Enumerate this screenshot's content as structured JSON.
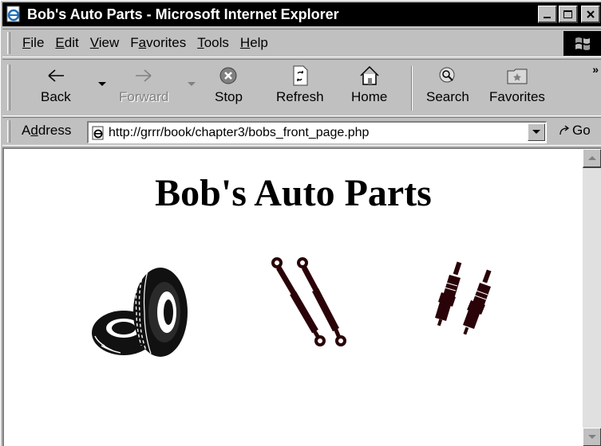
{
  "window": {
    "title": "Bob's Auto Parts - Microsoft Internet Explorer",
    "icon": "ie-page-icon",
    "buttons": [
      "minimize-icon",
      "maximize-icon",
      "close-icon"
    ]
  },
  "menu": {
    "items": [
      {
        "label": "File",
        "accel": "F",
        "rest": "ile"
      },
      {
        "label": "Edit",
        "accel": "E",
        "rest": "dit"
      },
      {
        "label": "View",
        "accel": "V",
        "rest": "iew"
      },
      {
        "label": "Favorites",
        "pre": "F",
        "accel": "a",
        "rest": "vorites"
      },
      {
        "label": "Tools",
        "accel": "T",
        "rest": "ools"
      },
      {
        "label": "Help",
        "accel": "H",
        "rest": "elp"
      }
    ]
  },
  "toolbar": {
    "back": {
      "label": "Back",
      "icon": "back-arrow-icon",
      "enabled": true
    },
    "forward": {
      "label": "Forward",
      "icon": "forward-arrow-icon",
      "enabled": false
    },
    "stop": {
      "label": "Stop",
      "icon": "stop-icon"
    },
    "refresh": {
      "label": "Refresh",
      "icon": "refresh-icon"
    },
    "home": {
      "label": "Home",
      "icon": "home-icon"
    },
    "search": {
      "label": "Search",
      "icon": "search-icon"
    },
    "favorites": {
      "label": "Favorites",
      "icon": "favorites-icon"
    },
    "more": "»"
  },
  "address": {
    "label_pre": "A",
    "label_accel": "d",
    "label_rest": "dress",
    "url": "http://grrr/book/chapter3/bobs_front_page.php",
    "go_label": "Go"
  },
  "page": {
    "heading": "Bob's Auto Parts",
    "images": [
      {
        "name": "tires-image",
        "alt": "tires"
      },
      {
        "name": "shock-absorbers-image",
        "alt": "shock absorbers"
      },
      {
        "name": "spark-plugs-image",
        "alt": "spark plugs"
      }
    ]
  },
  "colors": {
    "titlebar": "#000000",
    "chrome": "#c0c0c0",
    "page_background": "#ffffff",
    "product_dark": "#2a0308"
  }
}
